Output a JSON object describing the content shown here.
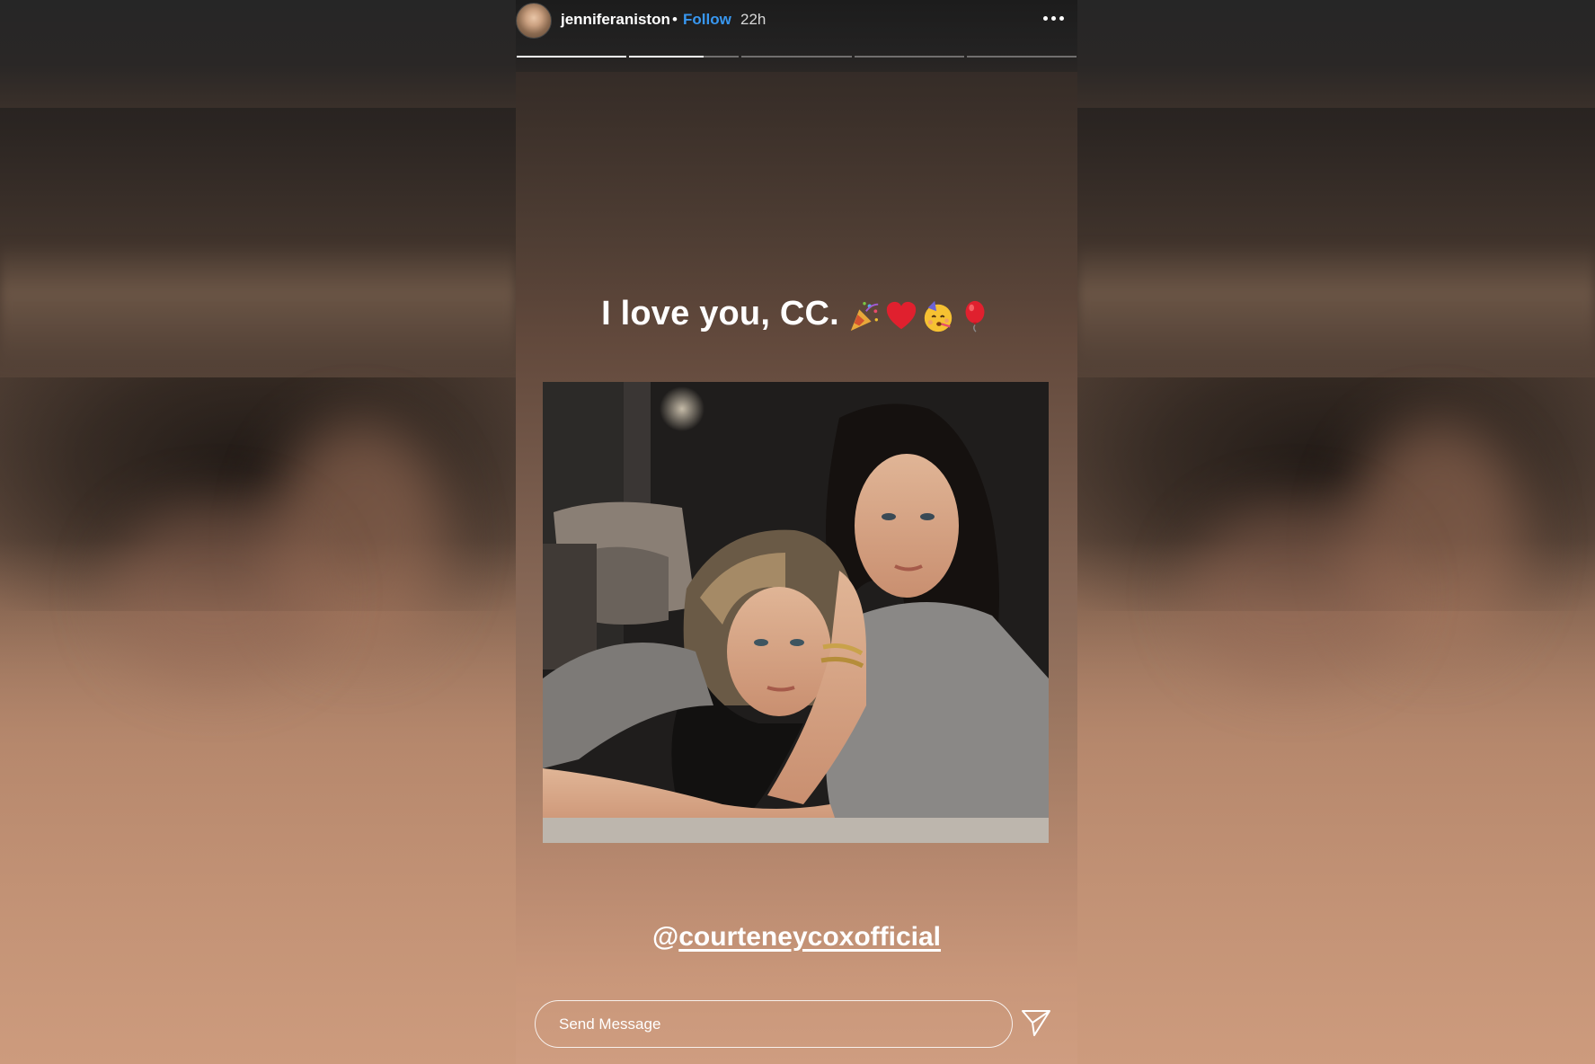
{
  "story": {
    "username": "jenniferaniston",
    "separator": "•",
    "follow_label": "Follow",
    "timestamp": "22h",
    "progress": [
      1.0,
      0.68,
      0,
      0,
      0
    ],
    "caption_text": "I love you, CC.",
    "caption_emojis": [
      "party-popper-emoji",
      "red-heart-emoji",
      "partying-face-emoji",
      "balloon-emoji"
    ],
    "mention_at": "@",
    "mention_handle": "courteneycoxofficial"
  },
  "footer": {
    "message_placeholder": "Send Message"
  },
  "colors": {
    "follow_blue": "#3897f0",
    "text": "#ffffff"
  }
}
